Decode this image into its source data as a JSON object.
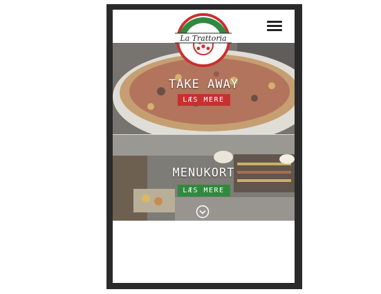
{
  "brand": {
    "name": "La Trattoria"
  },
  "header": {
    "menu_icon": "hamburger-icon"
  },
  "sections": [
    {
      "title": "TAKE AWAY",
      "cta_label": "LÆS MERE",
      "cta_color": "#c8302f"
    },
    {
      "title": "MENUKORT",
      "cta_label": "LÆS MERE",
      "cta_color": "#2f8a3e"
    }
  ],
  "scroll_icon": "chevron-down-circle-icon",
  "colors": {
    "frame": "#2a2a2a",
    "red": "#c8302f",
    "green": "#2f8a3e"
  }
}
